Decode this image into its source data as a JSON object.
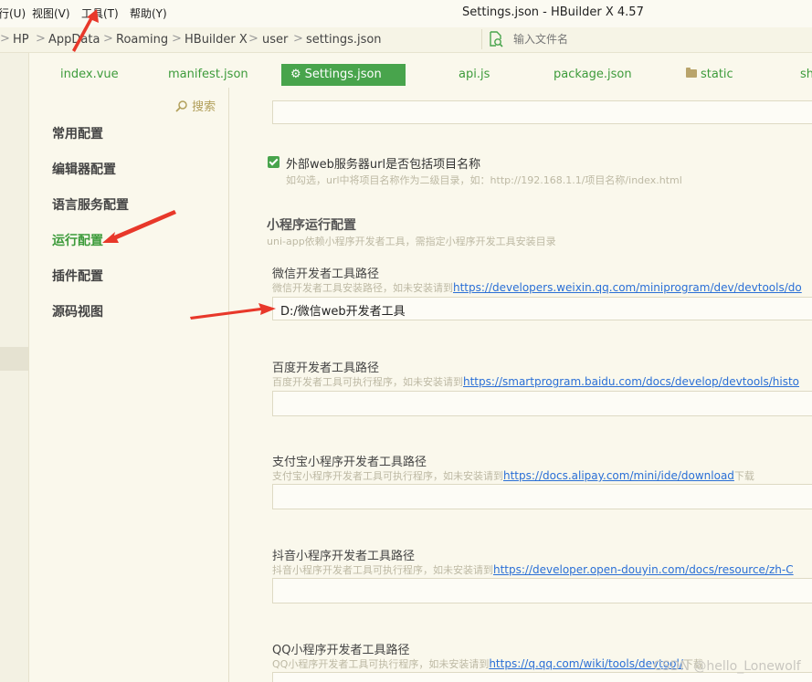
{
  "menubar": {
    "items": [
      "行(U)",
      "视图(V)",
      "工具(T)",
      "帮助(Y)"
    ],
    "window_title": "Settings.json - HBuilder X 4.57"
  },
  "breadcrumb": {
    "items": [
      "HP",
      "AppData",
      "Roaming",
      "HBuilder X",
      "user",
      "settings.json"
    ],
    "separator": ">"
  },
  "file_search": {
    "placeholder": "输入文件名",
    "icon": "file-search-icon"
  },
  "tabs": [
    {
      "label": "index.vue"
    },
    {
      "label": "manifest.json"
    },
    {
      "label": "Settings.json",
      "icon": "gear-icon",
      "active": true
    },
    {
      "label": "api.js"
    },
    {
      "label": "package.json"
    },
    {
      "label": "static",
      "icon": "folder-icon"
    },
    {
      "label": "sh"
    }
  ],
  "settings_nav": {
    "search_label": "搜索",
    "search_icon": "search-icon",
    "items": [
      "常用配置",
      "编辑器配置",
      "语言服务配置",
      "运行配置",
      "插件配置",
      "源码视图"
    ],
    "active_index": 3
  },
  "content": {
    "web_server_checkbox": {
      "checked": true,
      "label": "外部web服务器url是否包括项目名称",
      "hint": "如勾选，url中将项目名称作为二级目录，如：http://192.168.1.1/项目名称/index.html"
    },
    "mp_section": {
      "title": "小程序运行配置",
      "subtitle": "uni-app依赖小程序开发者工具，需指定小程序开发工具安装目录"
    },
    "fields": [
      {
        "label": "微信开发者工具路径",
        "hint_prefix": "微信开发者工具安装路径，如未安装请到",
        "link": "https://developers.weixin.qq.com/miniprogram/dev/devtools/do",
        "hint_suffix": "",
        "value": "D:/微信web开发者工具"
      },
      {
        "label": "百度开发者工具路径",
        "hint_prefix": "百度开发者工具可执行程序，如未安装请到",
        "link": "https://smartprogram.baidu.com/docs/develop/devtools/histo",
        "hint_suffix": "",
        "value": ""
      },
      {
        "label": "支付宝小程序开发者工具路径",
        "hint_prefix": "支付宝小程序开发者工具可执行程序，如未安装请到",
        "link": "https://docs.alipay.com/mini/ide/download",
        "hint_suffix": "下载",
        "value": ""
      },
      {
        "label": "抖音小程序开发者工具路径",
        "hint_prefix": "抖音小程序开发者工具可执行程序，如未安装请到",
        "link": "https://developer.open-douyin.com/docs/resource/zh-C",
        "hint_suffix": "",
        "value": ""
      },
      {
        "label": "QQ小程序开发者工具路径",
        "hint_prefix": "QQ小程序开发者工具可执行程序，如未安装请到",
        "link": "https://q.qq.com/wiki/tools/devtool/",
        "hint_suffix": "下载",
        "value": ""
      }
    ]
  },
  "watermark": "CSDN @hello_Lonewolf",
  "colors": {
    "accent": "#48a44c",
    "link": "#2a6fd6",
    "arrow": "#e8382a",
    "background": "#faf8ec"
  }
}
